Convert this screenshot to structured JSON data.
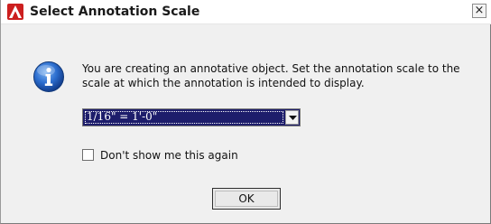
{
  "window": {
    "title": "Select Annotation Scale",
    "close_label": "×"
  },
  "dialog": {
    "message": "You are creating an annotative object.  Set the annotation scale to the scale at which the annotation is intended to display.",
    "scale_select": {
      "selected_value": "1/16\" = 1'-0\""
    },
    "dont_show_again": {
      "label": "Don't show me this again",
      "checked": false
    },
    "ok_label": "OK"
  },
  "colors": {
    "app_icon_red": "#cc1f1f",
    "info_blue": "#1f5fbf",
    "combo_selected_bg": "#1d1d6b"
  },
  "icons": {
    "app": "autocad-a-icon",
    "info": "information-icon",
    "close": "close-icon",
    "dropdown": "chevron-down-icon"
  }
}
